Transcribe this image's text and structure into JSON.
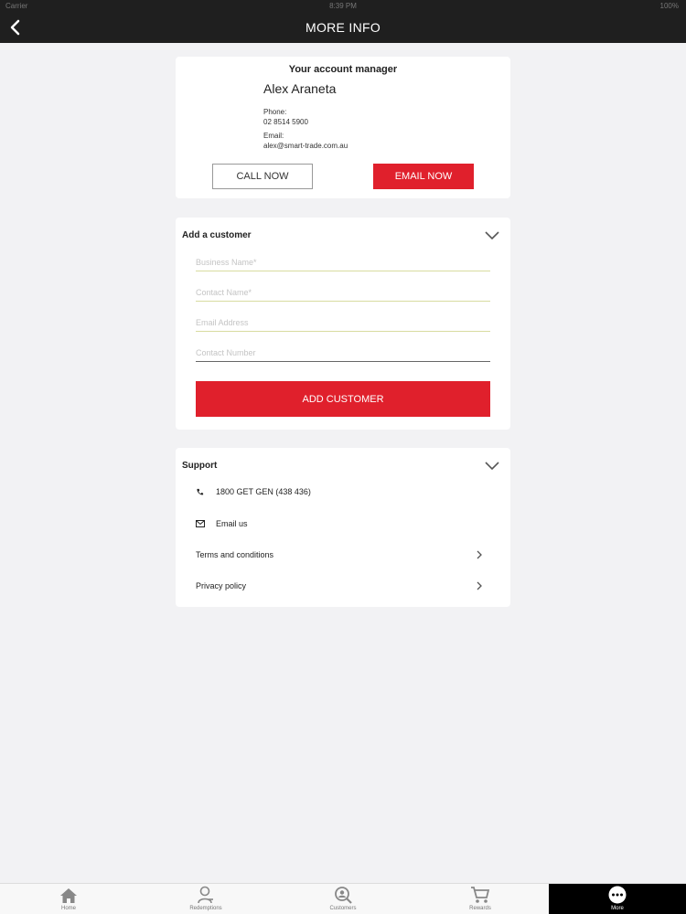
{
  "status": {
    "carrier": "Carrier",
    "time": "8:39 PM",
    "battery": "100%"
  },
  "nav": {
    "title": "MORE INFO"
  },
  "manager": {
    "heading": "Your account manager",
    "name": "Alex Araneta",
    "phone_label": "Phone:",
    "phone": "02 8514 5900",
    "email_label": "Email:",
    "email": "alex@smart-trade.com.au",
    "call_label": "CALL NOW",
    "email_button_label": "EMAIL NOW"
  },
  "add_customer": {
    "title": "Add a customer",
    "business_placeholder": "Business Name*",
    "contact_placeholder": "Contact Name*",
    "email_placeholder": "Email Address",
    "number_placeholder": "Contact Number",
    "button_label": "ADD CUSTOMER"
  },
  "support": {
    "title": "Support",
    "phone": "1800 GET GEN (438 436)",
    "email": "Email us",
    "terms": "Terms and conditions",
    "privacy": "Privacy policy"
  },
  "tabs": [
    {
      "label": "Home",
      "icon": "home-icon"
    },
    {
      "label": "Redemptions",
      "icon": "person-icon"
    },
    {
      "label": "Customers",
      "icon": "customers-search-icon"
    },
    {
      "label": "Rewards",
      "icon": "cart-icon"
    },
    {
      "label": "More",
      "icon": "more-icon",
      "active": true
    }
  ],
  "colors": {
    "accent": "#e0202c",
    "header": "#1f1f1f",
    "background": "#f2f2f4"
  }
}
